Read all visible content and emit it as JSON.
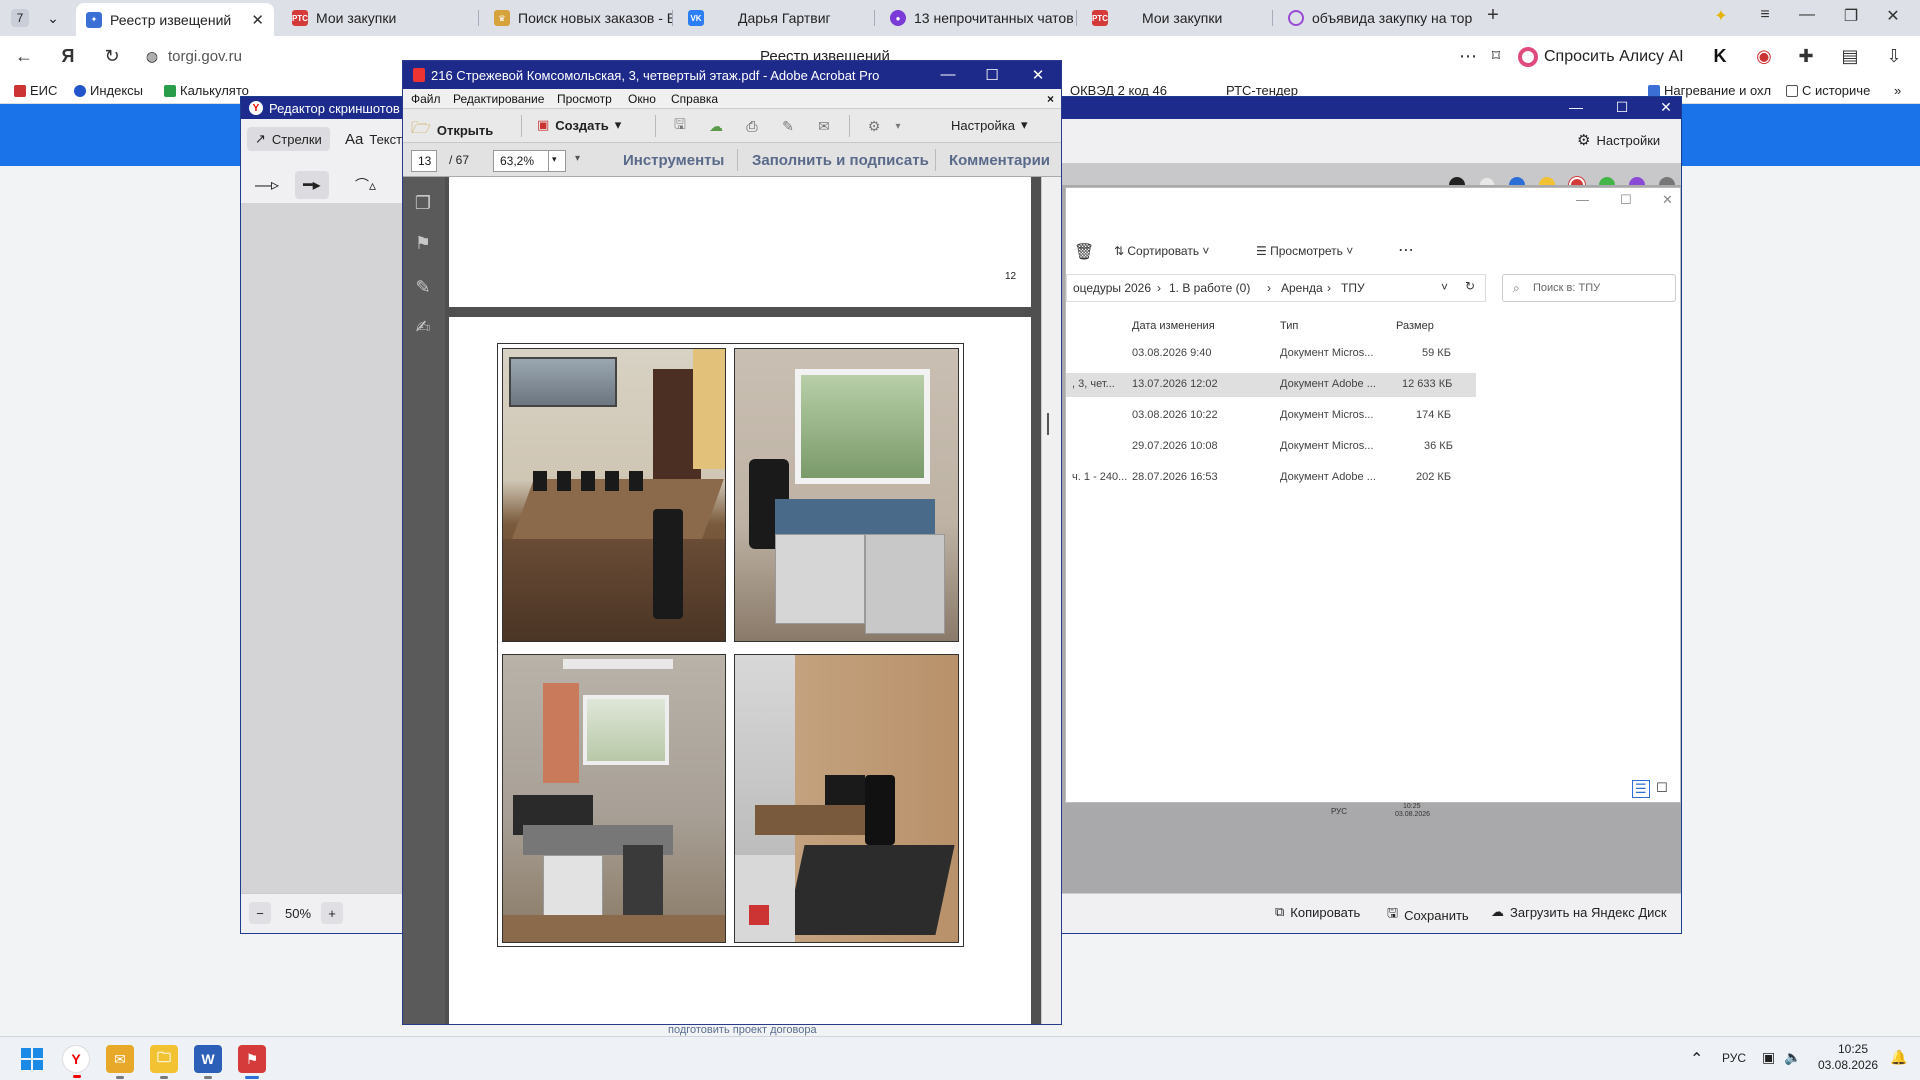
{
  "browser": {
    "tab_count": "7",
    "tabs": [
      {
        "label": "Реестр извещений",
        "favicon": "eagle",
        "color": "#3b6fd6"
      },
      {
        "label": "Мои закупки",
        "favicon": "РТС",
        "color": "#d63b3b"
      },
      {
        "label": "Поиск новых заказов - Вс",
        "favicon": "crown",
        "color": "#d6a23b"
      },
      {
        "label": "Дарья Гартвиг",
        "favicon": "VK",
        "color": "#2d7ff9"
      },
      {
        "label": "13 непрочитанных чатов",
        "favicon": "chat",
        "color": "#7a3bd6"
      },
      {
        "label": "Мои закупки",
        "favicon": "РТС",
        "color": "#d63b3b"
      },
      {
        "label": "объявида закупку на тор",
        "favicon": "alice",
        "color": "#9a4ad6"
      }
    ],
    "url": "torgi.gov.ru",
    "page_title": "Реестр извещений",
    "alice_label": "Спросить Алису AI",
    "bookmarks": [
      {
        "label": "ЕИС",
        "color": "#c33"
      },
      {
        "label": "Индексы",
        "color": "#2255cc"
      },
      {
        "label": "Калькулято",
        "color": "#2a9d4a"
      },
      {
        "label": "ОКВЭД 2 код 46",
        "color": "#555"
      },
      {
        "label": "РТС-тендер",
        "color": "#d63b3b"
      },
      {
        "label": "Нагревание и охл",
        "color": "#3b6fd6"
      },
      {
        "label": "С историче",
        "color": "#555"
      }
    ]
  },
  "site": {
    "bottom_text": "подготовить проект договора"
  },
  "editor": {
    "title": "Редактор скриншотов -",
    "tool_arrows": "Стрелки",
    "tool_text": "Текст",
    "settings": "Настройки",
    "zoom": "50%",
    "copy": "Копировать",
    "save": "Сохранить",
    "upload": "Загрузить на Яндекс Диск",
    "swatches": [
      "#222222",
      "#e8e8e8",
      "#2b6fd6",
      "#f2c232",
      "#d63b3b",
      "#44b549",
      "#8a4ad6",
      "#777777"
    ]
  },
  "explorer": {
    "sort": "Сортировать",
    "view": "Просмотреть",
    "breadcrumb": [
      "оцедуры 2026",
      "1. В работе (0)",
      "Аренда",
      "ТПУ"
    ],
    "search_placeholder": "Поиск в: ТПУ",
    "columns": [
      "Дата изменения",
      "Тип",
      "Размер"
    ],
    "rows": [
      {
        "name": "",
        "date": "03.08.2026 9:40",
        "type": "Документ Micros...",
        "size": "59 КБ"
      },
      {
        "name": ", 3, чет...",
        "date": "13.07.2026 12:02",
        "type": "Документ Adobe ...",
        "size": "12 633 КБ"
      },
      {
        "name": "",
        "date": "03.08.2026 10:22",
        "type": "Документ Micros...",
        "size": "174 КБ"
      },
      {
        "name": "",
        "date": "29.07.2026 10:08",
        "type": "Документ Micros...",
        "size": "36 КБ"
      },
      {
        "name": "ч. 1 - 240...",
        "date": "28.07.2026 16:53",
        "type": "Документ Adobe ...",
        "size": "202 КБ"
      }
    ],
    "tray_lang": "РУС",
    "tray_time": "10:25",
    "tray_date": "03.08.2026"
  },
  "acrobat": {
    "title": "216 Стрежевой Комсомольская,  3, четвертый этаж.pdf - Adobe Acrobat Pro",
    "menu": [
      "Файл",
      "Редактирование",
      "Просмотр",
      "Окно",
      "Справка"
    ],
    "open": "Открыть",
    "create": "Создать",
    "customize": "Настройка",
    "page_current": "13",
    "page_total": "/ 67",
    "zoom": "63,2%",
    "tools": "Инструменты",
    "fill_sign": "Заполнить и подписать",
    "comments": "Комментарии",
    "page_number_label": "12"
  },
  "taskbar": {
    "lang": "РУС",
    "time": "10:25",
    "date": "03.08.2026"
  }
}
